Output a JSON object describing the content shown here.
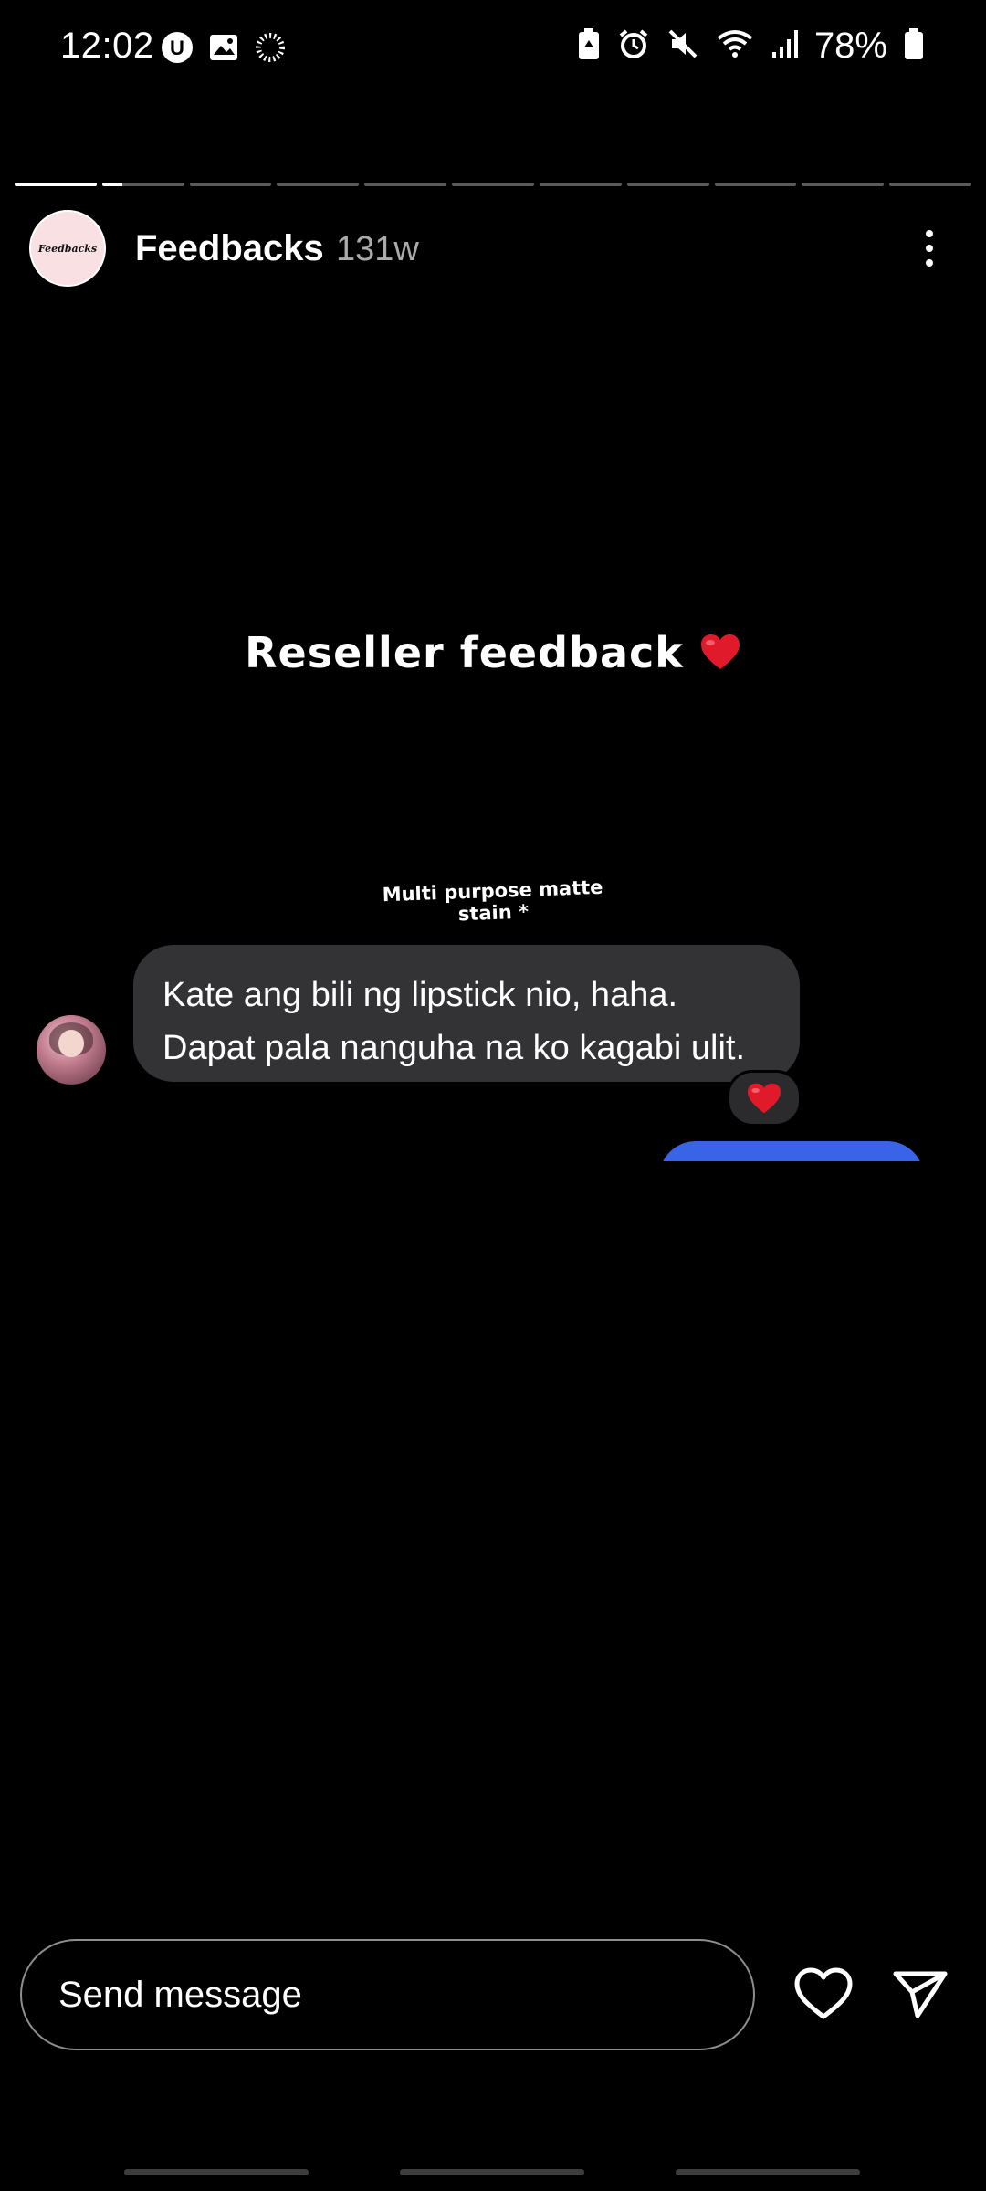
{
  "status_bar": {
    "time": "12:02",
    "battery": "78%",
    "left_icons": [
      "u-badge-icon",
      "image-icon",
      "loading-ring-icon"
    ],
    "right_icons": [
      "battery-saver-icon",
      "alarm-icon",
      "mute-icon",
      "wifi-icon",
      "signal-icon",
      "battery-icon"
    ]
  },
  "progress": {
    "segment_count": 11,
    "active_index": 1,
    "active_fraction": 0.25
  },
  "header": {
    "avatar_logo_text": "Feedbacks",
    "title": "Feedbacks",
    "time_ago": "131w",
    "more_icon": "more-vertical-icon"
  },
  "story": {
    "heading": "Reseller feedback",
    "heading_emoji": "❤️",
    "annotation_line1": "Multi purpose matte",
    "annotation_line2": "stain *",
    "message_line1": "Kate ang bili ng lipstick nio, haha.",
    "message_line2": "Dapat pala nanguha na ko kagabi ulit.",
    "reaction": "❤️"
  },
  "footer": {
    "input_placeholder": "Send message",
    "like_icon": "heart-outline-icon",
    "send_icon": "send-icon"
  },
  "colors": {
    "background": "#000000",
    "bubble": "#333336",
    "outgoing_bubble": "#3a64e8",
    "heart": "#e0192b"
  }
}
